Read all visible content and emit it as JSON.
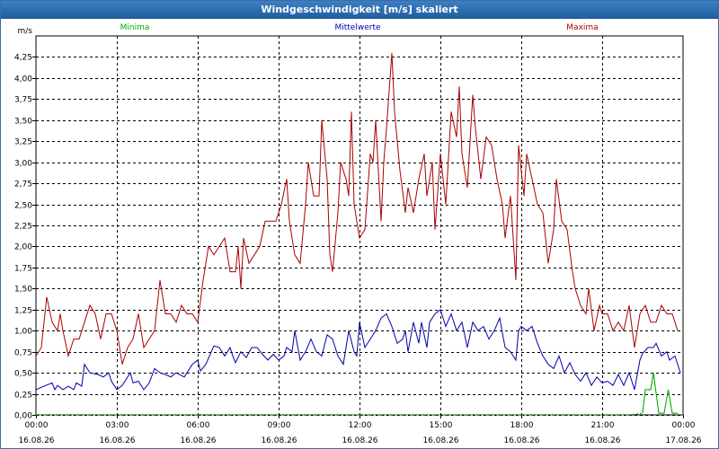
{
  "window": {
    "title": "Windgeschwindigkeit [m/s] skaliert"
  },
  "colors": {
    "minima": "#00aa00",
    "mittelwerte": "#0000aa",
    "maxima": "#aa0000",
    "titlebar": "#2a6aad"
  },
  "chart_data": {
    "type": "line",
    "title": "Windgeschwindigkeit [m/s] skaliert",
    "ylabel": "m/s",
    "ylim": [
      0,
      4.5
    ],
    "yticks": [
      "0,00",
      "0,25",
      "0,50",
      "0,75",
      "1,00",
      "1,25",
      "1,50",
      "1,75",
      "2,00",
      "2,25",
      "2,50",
      "2,75",
      "3,00",
      "3,25",
      "3,50",
      "3,75",
      "4,00",
      "4,25"
    ],
    "xlim": [
      0,
      24
    ],
    "xticks": [
      {
        "time": "00:00",
        "date": "16.08.26"
      },
      {
        "time": "03:00",
        "date": "16.08.26"
      },
      {
        "time": "06:00",
        "date": "16.08.26"
      },
      {
        "time": "09:00",
        "date": "16.08.26"
      },
      {
        "time": "12:00",
        "date": "16.08.26"
      },
      {
        "time": "15:00",
        "date": "16.08.26"
      },
      {
        "time": "18:00",
        "date": "16.08.26"
      },
      {
        "time": "21:00",
        "date": "16.08.26"
      },
      {
        "time": "00:00",
        "date": "17.08.26"
      }
    ],
    "grid": true,
    "legend_position": "top",
    "series": [
      {
        "name": "Minima",
        "values": [
          [
            0,
            0
          ],
          [
            1,
            0
          ],
          [
            2,
            0
          ],
          [
            3,
            0
          ],
          [
            4,
            0
          ],
          [
            5,
            0
          ],
          [
            6,
            0
          ],
          [
            7,
            0
          ],
          [
            8,
            0
          ],
          [
            9,
            0
          ],
          [
            10,
            0
          ],
          [
            11,
            0
          ],
          [
            12,
            0
          ],
          [
            13,
            0
          ],
          [
            14,
            0
          ],
          [
            15,
            0
          ],
          [
            16,
            0
          ],
          [
            17,
            0
          ],
          [
            18,
            0
          ],
          [
            19,
            0
          ],
          [
            20,
            0
          ],
          [
            21,
            0
          ],
          [
            22,
            0
          ],
          [
            22.5,
            0.02
          ],
          [
            22.6,
            0.3
          ],
          [
            22.8,
            0.3
          ],
          [
            22.9,
            0.5
          ],
          [
            23.1,
            0.02
          ],
          [
            23.3,
            0.02
          ],
          [
            23.45,
            0.3
          ],
          [
            23.6,
            0.02
          ],
          [
            23.8,
            0.02
          ]
        ]
      },
      {
        "name": "Mittelwerte",
        "values": [
          [
            0,
            0.3
          ],
          [
            0.3,
            0.34
          ],
          [
            0.6,
            0.38
          ],
          [
            0.7,
            0.3
          ],
          [
            0.8,
            0.35
          ],
          [
            1.0,
            0.3
          ],
          [
            1.2,
            0.34
          ],
          [
            1.4,
            0.3
          ],
          [
            1.5,
            0.38
          ],
          [
            1.7,
            0.34
          ],
          [
            1.8,
            0.6
          ],
          [
            2.0,
            0.5
          ],
          [
            2.3,
            0.48
          ],
          [
            2.5,
            0.45
          ],
          [
            2.7,
            0.5
          ],
          [
            2.8,
            0.4
          ],
          [
            3.0,
            0.3
          ],
          [
            3.2,
            0.35
          ],
          [
            3.5,
            0.5
          ],
          [
            3.6,
            0.38
          ],
          [
            3.8,
            0.4
          ],
          [
            4.0,
            0.3
          ],
          [
            4.2,
            0.38
          ],
          [
            4.4,
            0.55
          ],
          [
            4.6,
            0.5
          ],
          [
            4.8,
            0.48
          ],
          [
            5.0,
            0.45
          ],
          [
            5.2,
            0.5
          ],
          [
            5.5,
            0.45
          ],
          [
            5.8,
            0.6
          ],
          [
            6.0,
            0.65
          ],
          [
            6.1,
            0.52
          ],
          [
            6.3,
            0.6
          ],
          [
            6.6,
            0.82
          ],
          [
            6.8,
            0.8
          ],
          [
            7.0,
            0.7
          ],
          [
            7.2,
            0.8
          ],
          [
            7.3,
            0.7
          ],
          [
            7.4,
            0.62
          ],
          [
            7.6,
            0.75
          ],
          [
            7.8,
            0.68
          ],
          [
            8.0,
            0.8
          ],
          [
            8.2,
            0.8
          ],
          [
            8.4,
            0.72
          ],
          [
            8.6,
            0.65
          ],
          [
            8.8,
            0.72
          ],
          [
            9.0,
            0.65
          ],
          [
            9.2,
            0.7
          ],
          [
            9.3,
            0.8
          ],
          [
            9.5,
            0.75
          ],
          [
            9.6,
            1.0
          ],
          [
            9.8,
            0.65
          ],
          [
            10.0,
            0.75
          ],
          [
            10.2,
            0.9
          ],
          [
            10.4,
            0.75
          ],
          [
            10.6,
            0.7
          ],
          [
            10.8,
            0.95
          ],
          [
            11.0,
            0.9
          ],
          [
            11.2,
            0.7
          ],
          [
            11.4,
            0.6
          ],
          [
            11.6,
            1.0
          ],
          [
            11.8,
            0.75
          ],
          [
            11.9,
            0.7
          ],
          [
            12.0,
            1.1
          ],
          [
            12.2,
            0.8
          ],
          [
            12.4,
            0.9
          ],
          [
            12.6,
            1.0
          ],
          [
            12.8,
            1.15
          ],
          [
            13.0,
            1.2
          ],
          [
            13.2,
            1.05
          ],
          [
            13.4,
            0.85
          ],
          [
            13.6,
            0.9
          ],
          [
            13.7,
            1.0
          ],
          [
            13.8,
            0.75
          ],
          [
            14.0,
            1.1
          ],
          [
            14.2,
            0.85
          ],
          [
            14.3,
            1.1
          ],
          [
            14.5,
            0.8
          ],
          [
            14.6,
            1.1
          ],
          [
            14.8,
            1.2
          ],
          [
            15.0,
            1.25
          ],
          [
            15.2,
            1.05
          ],
          [
            15.4,
            1.2
          ],
          [
            15.6,
            1.0
          ],
          [
            15.8,
            1.1
          ],
          [
            16.0,
            0.8
          ],
          [
            16.2,
            1.1
          ],
          [
            16.4,
            1.0
          ],
          [
            16.6,
            1.05
          ],
          [
            16.8,
            0.9
          ],
          [
            17.0,
            1.0
          ],
          [
            17.2,
            1.15
          ],
          [
            17.4,
            0.8
          ],
          [
            17.6,
            0.75
          ],
          [
            17.8,
            0.65
          ],
          [
            17.9,
            1.0
          ],
          [
            18.0,
            1.05
          ],
          [
            18.2,
            1.0
          ],
          [
            18.4,
            1.05
          ],
          [
            18.6,
            0.85
          ],
          [
            18.8,
            0.7
          ],
          [
            19.0,
            0.6
          ],
          [
            19.2,
            0.55
          ],
          [
            19.4,
            0.7
          ],
          [
            19.6,
            0.5
          ],
          [
            19.8,
            0.62
          ],
          [
            19.9,
            0.55
          ],
          [
            20.0,
            0.48
          ],
          [
            20.2,
            0.4
          ],
          [
            20.4,
            0.5
          ],
          [
            20.6,
            0.35
          ],
          [
            20.8,
            0.45
          ],
          [
            21.0,
            0.38
          ],
          [
            21.2,
            0.4
          ],
          [
            21.4,
            0.35
          ],
          [
            21.6,
            0.48
          ],
          [
            21.8,
            0.35
          ],
          [
            22.0,
            0.5
          ],
          [
            22.2,
            0.3
          ],
          [
            22.4,
            0.65
          ],
          [
            22.5,
            0.73
          ],
          [
            22.7,
            0.8
          ],
          [
            22.9,
            0.8
          ],
          [
            23.0,
            0.85
          ],
          [
            23.2,
            0.7
          ],
          [
            23.4,
            0.75
          ],
          [
            23.5,
            0.65
          ],
          [
            23.7,
            0.7
          ],
          [
            23.9,
            0.5
          ]
        ]
      },
      {
        "name": "Maxima",
        "values": [
          [
            0,
            0.7
          ],
          [
            0.2,
            0.8
          ],
          [
            0.4,
            1.4
          ],
          [
            0.6,
            1.1
          ],
          [
            0.8,
            1.0
          ],
          [
            0.9,
            1.2
          ],
          [
            1.0,
            1.0
          ],
          [
            1.2,
            0.7
          ],
          [
            1.4,
            0.9
          ],
          [
            1.6,
            0.9
          ],
          [
            1.8,
            1.1
          ],
          [
            2.0,
            1.3
          ],
          [
            2.2,
            1.2
          ],
          [
            2.4,
            0.9
          ],
          [
            2.6,
            1.2
          ],
          [
            2.8,
            1.2
          ],
          [
            3.0,
            1.0
          ],
          [
            3.2,
            0.6
          ],
          [
            3.4,
            0.8
          ],
          [
            3.6,
            0.9
          ],
          [
            3.8,
            1.2
          ],
          [
            4.0,
            0.8
          ],
          [
            4.2,
            0.9
          ],
          [
            4.4,
            1.0
          ],
          [
            4.6,
            1.6
          ],
          [
            4.8,
            1.2
          ],
          [
            5.0,
            1.2
          ],
          [
            5.2,
            1.1
          ],
          [
            5.4,
            1.3
          ],
          [
            5.6,
            1.2
          ],
          [
            5.8,
            1.2
          ],
          [
            6.0,
            1.1
          ],
          [
            6.2,
            1.6
          ],
          [
            6.4,
            2.0
          ],
          [
            6.6,
            1.9
          ],
          [
            6.8,
            2.0
          ],
          [
            7.0,
            2.1
          ],
          [
            7.2,
            1.7
          ],
          [
            7.4,
            1.7
          ],
          [
            7.5,
            2.0
          ],
          [
            7.6,
            1.5
          ],
          [
            7.7,
            2.1
          ],
          [
            7.9,
            1.8
          ],
          [
            8.1,
            1.9
          ],
          [
            8.3,
            2.0
          ],
          [
            8.5,
            2.3
          ],
          [
            8.7,
            2.3
          ],
          [
            8.9,
            2.3
          ],
          [
            9.1,
            2.5
          ],
          [
            9.3,
            2.8
          ],
          [
            9.4,
            2.3
          ],
          [
            9.6,
            1.9
          ],
          [
            9.8,
            1.8
          ],
          [
            10.0,
            2.5
          ],
          [
            10.1,
            3.0
          ],
          [
            10.3,
            2.6
          ],
          [
            10.5,
            2.6
          ],
          [
            10.6,
            3.5
          ],
          [
            10.8,
            2.8
          ],
          [
            10.9,
            1.9
          ],
          [
            11.0,
            1.7
          ],
          [
            11.2,
            2.4
          ],
          [
            11.3,
            3.0
          ],
          [
            11.5,
            2.8
          ],
          [
            11.6,
            2.6
          ],
          [
            11.7,
            3.6
          ],
          [
            11.8,
            2.5
          ],
          [
            12.0,
            2.1
          ],
          [
            12.2,
            2.2
          ],
          [
            12.4,
            3.1
          ],
          [
            12.5,
            3.0
          ],
          [
            12.6,
            3.5
          ],
          [
            12.8,
            2.3
          ],
          [
            12.9,
            3.0
          ],
          [
            13.0,
            3.4
          ],
          [
            13.2,
            4.3
          ],
          [
            13.3,
            3.6
          ],
          [
            13.5,
            2.9
          ],
          [
            13.7,
            2.4
          ],
          [
            13.8,
            2.7
          ],
          [
            14.0,
            2.4
          ],
          [
            14.2,
            2.8
          ],
          [
            14.4,
            3.1
          ],
          [
            14.5,
            2.6
          ],
          [
            14.7,
            3.0
          ],
          [
            14.8,
            2.2
          ],
          [
            15.0,
            3.1
          ],
          [
            15.2,
            2.5
          ],
          [
            15.4,
            3.6
          ],
          [
            15.6,
            3.3
          ],
          [
            15.7,
            3.9
          ],
          [
            15.8,
            3.1
          ],
          [
            16.0,
            2.7
          ],
          [
            16.2,
            3.8
          ],
          [
            16.3,
            3.4
          ],
          [
            16.5,
            2.8
          ],
          [
            16.7,
            3.3
          ],
          [
            16.9,
            3.2
          ],
          [
            17.1,
            2.8
          ],
          [
            17.3,
            2.5
          ],
          [
            17.4,
            2.1
          ],
          [
            17.6,
            2.6
          ],
          [
            17.8,
            1.6
          ],
          [
            17.9,
            3.2
          ],
          [
            18.1,
            2.6
          ],
          [
            18.2,
            3.1
          ],
          [
            18.4,
            2.8
          ],
          [
            18.6,
            2.5
          ],
          [
            18.8,
            2.4
          ],
          [
            19.0,
            1.8
          ],
          [
            19.2,
            2.2
          ],
          [
            19.3,
            2.8
          ],
          [
            19.5,
            2.3
          ],
          [
            19.7,
            2.2
          ],
          [
            19.9,
            1.7
          ],
          [
            20.0,
            1.5
          ],
          [
            20.2,
            1.3
          ],
          [
            20.4,
            1.2
          ],
          [
            20.5,
            1.5
          ],
          [
            20.7,
            1.0
          ],
          [
            20.9,
            1.3
          ],
          [
            21.0,
            1.2
          ],
          [
            21.2,
            1.2
          ],
          [
            21.4,
            1.0
          ],
          [
            21.6,
            1.1
          ],
          [
            21.8,
            1.0
          ],
          [
            22.0,
            1.3
          ],
          [
            22.2,
            0.8
          ],
          [
            22.4,
            1.2
          ],
          [
            22.6,
            1.3
          ],
          [
            22.8,
            1.1
          ],
          [
            23.0,
            1.1
          ],
          [
            23.2,
            1.3
          ],
          [
            23.4,
            1.2
          ],
          [
            23.6,
            1.2
          ],
          [
            23.8,
            1.0
          ]
        ]
      }
    ]
  }
}
